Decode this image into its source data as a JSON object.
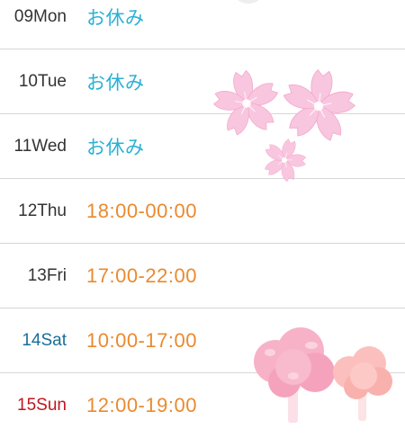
{
  "schedule": [
    {
      "day": "09Mon",
      "kind": "normal",
      "status": "お休み",
      "type": "off"
    },
    {
      "day": "10Tue",
      "kind": "normal",
      "status": "お休み",
      "type": "off"
    },
    {
      "day": "11Wed",
      "kind": "normal",
      "status": "お休み",
      "type": "off"
    },
    {
      "day": "12Thu",
      "kind": "normal",
      "status": "18:00-00:00",
      "type": "time"
    },
    {
      "day": "13Fri",
      "kind": "normal",
      "status": "17:00-22:00",
      "type": "time"
    },
    {
      "day": "14Sat",
      "kind": "sat",
      "status": "10:00-17:00",
      "type": "time"
    },
    {
      "day": "15Sun",
      "kind": "sun",
      "status": "12:00-19:00",
      "type": "time"
    }
  ],
  "decorations": {
    "flowers": "sakura-blossom-icon",
    "trees": "cherry-tree-icon"
  },
  "colors": {
    "off": "#2ab1d4",
    "time": "#ea8a2e",
    "saturday": "#1a6d99",
    "sunday": "#c0161d",
    "divider": "#d6d6d6",
    "blossom": "#f9c2da"
  }
}
